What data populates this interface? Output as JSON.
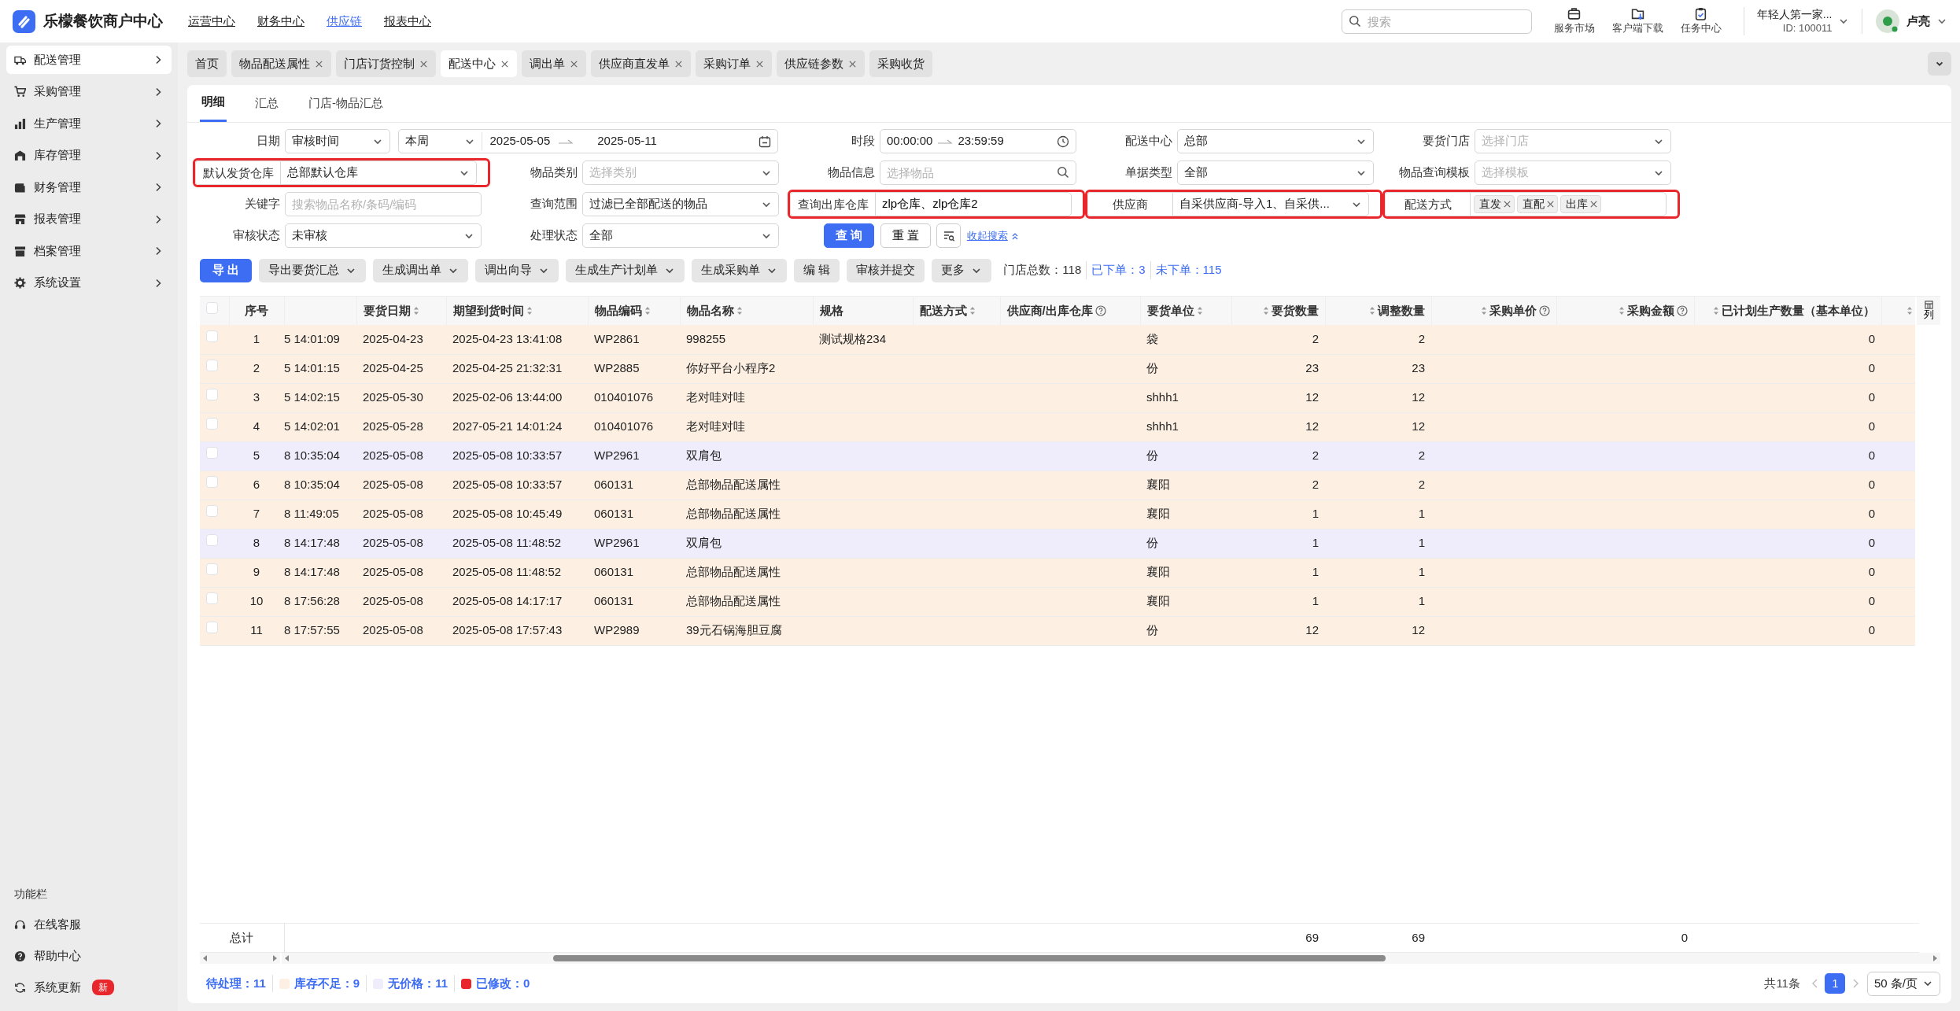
{
  "app": {
    "name": "乐檬餐饮商户中心"
  },
  "top_nav": [
    {
      "label": "运营中心",
      "selected": false
    },
    {
      "label": "财务中心",
      "selected": false
    },
    {
      "label": "供应链",
      "selected": true
    },
    {
      "label": "报表中心",
      "selected": false
    }
  ],
  "search": {
    "placeholder": "搜索"
  },
  "shortcuts": [
    {
      "label": "服务市场"
    },
    {
      "label": "客户端下载"
    },
    {
      "label": "任务中心"
    }
  ],
  "account": {
    "name": "年轻人第一家...",
    "id": "ID: 100011"
  },
  "user": {
    "name": "卢亮"
  },
  "sidebar": {
    "items": [
      {
        "label": "配送管理",
        "selected": true
      },
      {
        "label": "采购管理",
        "selected": false
      },
      {
        "label": "生产管理",
        "selected": false
      },
      {
        "label": "库存管理",
        "selected": false
      },
      {
        "label": "财务管理",
        "selected": false
      },
      {
        "label": "报表管理",
        "selected": false
      },
      {
        "label": "档案管理",
        "selected": false
      },
      {
        "label": "系统设置",
        "selected": false
      }
    ],
    "footer_title": "功能栏",
    "footer_items": [
      {
        "label": "在线客服"
      },
      {
        "label": "帮助中心"
      },
      {
        "label": "系统更新",
        "badge": "新"
      }
    ]
  },
  "page_tabs": [
    {
      "label": "首页",
      "selected": false,
      "closable": false
    },
    {
      "label": "物品配送属性",
      "selected": false,
      "closable": true
    },
    {
      "label": "门店订货控制",
      "selected": false,
      "closable": true
    },
    {
      "label": "配送中心",
      "selected": true,
      "closable": true
    },
    {
      "label": "调出单",
      "selected": false,
      "closable": true
    },
    {
      "label": "供应商直发单",
      "selected": false,
      "closable": true
    },
    {
      "label": "采购订单",
      "selected": false,
      "closable": true
    },
    {
      "label": "供应链参数",
      "selected": false,
      "closable": true
    },
    {
      "label": "采购收货",
      "selected": false,
      "closable": false
    }
  ],
  "sub_tabs": [
    {
      "label": "明细",
      "selected": true
    },
    {
      "label": "汇总",
      "selected": false
    },
    {
      "label": "门店-物品汇总",
      "selected": false
    }
  ],
  "filters": [
    {
      "label": "日期",
      "kind": "date",
      "type": "审核时间",
      "period": "本周",
      "start": "2025-05-05",
      "end": "2025-05-11",
      "highlighted": false
    },
    {
      "label": "时段",
      "kind": "time",
      "start": "00:00:00",
      "end": "23:59:59",
      "highlighted": false
    },
    {
      "label": "配送中心",
      "kind": "select",
      "value": "总部",
      "highlighted": false
    },
    {
      "label": "要货门店",
      "kind": "select",
      "placeholder": "选择门店",
      "highlighted": false
    },
    {
      "label": "默认发货仓库",
      "kind": "select",
      "value": "总部默认仓库",
      "highlighted": true
    },
    {
      "label": "物品类别",
      "kind": "select",
      "placeholder": "选择类别",
      "highlighted": false
    },
    {
      "label": "物品信息",
      "kind": "search",
      "placeholder": "选择物品",
      "highlighted": false
    },
    {
      "label": "单据类型",
      "kind": "select",
      "value": "全部",
      "highlighted": false
    },
    {
      "label": "物品查询模板",
      "kind": "select",
      "placeholder": "选择模板",
      "highlighted": false
    },
    {
      "label": "关键字",
      "kind": "text",
      "placeholder": "搜索物品名称/条码/编码",
      "highlighted": false
    },
    {
      "label": "查询范围",
      "kind": "select",
      "value": "过滤已全部配送的物品",
      "highlighted": false
    },
    {
      "label": "查询出库仓库",
      "kind": "text",
      "value": "zlp仓库、zlp仓库2",
      "highlighted": true
    },
    {
      "label": "供应商",
      "kind": "select",
      "value": "自采供应商-导入1、自采供...",
      "highlighted": true
    },
    {
      "label": "配送方式",
      "kind": "tags",
      "tags": [
        "直发",
        "直配",
        "出库"
      ],
      "highlighted": true
    },
    {
      "label": "审核状态",
      "kind": "select",
      "value": "未审核",
      "highlighted": false
    },
    {
      "label": "处理状态",
      "kind": "select",
      "value": "全部",
      "highlighted": false
    }
  ],
  "search_actions": {
    "buttons": [
      {
        "label": "查 询",
        "primary": true
      },
      {
        "label": "重 置",
        "primary": false
      }
    ],
    "collapse_link": "收起搜索"
  },
  "toolbar": {
    "buttons": [
      {
        "label": "导 出",
        "primary": true,
        "dropdown": false
      },
      {
        "label": "导出要货汇总",
        "primary": false,
        "dropdown": true
      },
      {
        "label": "生成调出单",
        "primary": false,
        "dropdown": true
      },
      {
        "label": "调出向导",
        "primary": false,
        "dropdown": true
      },
      {
        "label": "生成生产计划单",
        "primary": false,
        "dropdown": true
      },
      {
        "label": "生成采购单",
        "primary": false,
        "dropdown": true
      },
      {
        "label": "编 辑",
        "primary": false,
        "dropdown": false
      },
      {
        "label": "审核并提交",
        "primary": false,
        "dropdown": false
      },
      {
        "label": "更多",
        "primary": false,
        "dropdown": true
      }
    ],
    "stats": [
      {
        "label": "门店总数：118",
        "link": false
      },
      {
        "label": "已下单：3",
        "link": true
      },
      {
        "label": "未下单：115",
        "link": true
      }
    ]
  },
  "table": {
    "select_all": {
      "checked": false
    },
    "columns": [
      {
        "label": "序号",
        "sortable": false,
        "help": false
      },
      {
        "sortable": false,
        "help": false
      },
      {
        "label": "要货日期",
        "sortable": true,
        "help": false
      },
      {
        "label": "期望到货时间",
        "sortable": true,
        "help": false
      },
      {
        "label": "物品编码",
        "sortable": true,
        "help": false
      },
      {
        "label": "物品名称",
        "sortable": true,
        "help": false
      },
      {
        "label": "规格",
        "sortable": false,
        "help": false
      },
      {
        "label": "配送方式",
        "sortable": true,
        "help": false
      },
      {
        "label": "供应商/出库仓库",
        "sortable": false,
        "help": true
      },
      {
        "label": "要货单位",
        "sortable": true,
        "help": false
      },
      {
        "label": "要货数量",
        "sortable": true,
        "help": false
      },
      {
        "label": "调整数量",
        "sortable": true,
        "help": false
      },
      {
        "label": "采购单价",
        "sortable": true,
        "help": true
      },
      {
        "label": "采购金额",
        "sortable": true,
        "help": true
      },
      {
        "label": "已计划生产数量（基本单位）",
        "sortable": true,
        "help": false
      },
      {
        "sortable": true,
        "help": false
      }
    ],
    "column_settings": {
      "label": "列"
    },
    "rows": [
      {
        "checked": false,
        "low_stock": true,
        "no_price": false,
        "no": "1",
        "column_2": "5 14:01:09",
        "date": "2025-04-23",
        "expected": "2025-04-23 13:41:08",
        "code": "WP2861",
        "name": "998255",
        "spec": "测试规格234",
        "unit": "袋",
        "qty": "2",
        "adjusted": "2",
        "planned": "0"
      },
      {
        "checked": false,
        "low_stock": true,
        "no_price": false,
        "no": "2",
        "column_2": "5 14:01:15",
        "date": "2025-04-25",
        "expected": "2025-04-25 21:32:31",
        "code": "WP2885",
        "name": "你好平台小程序2",
        "unit": "份",
        "qty": "23",
        "adjusted": "23",
        "planned": "0"
      },
      {
        "checked": false,
        "low_stock": true,
        "no_price": false,
        "no": "3",
        "column_2": "5 14:02:15",
        "date": "2025-05-30",
        "expected": "2025-02-06 13:44:00",
        "code": "010401076",
        "name": "老对哇对哇",
        "unit": "shhh1",
        "qty": "12",
        "adjusted": "12",
        "planned": "0"
      },
      {
        "checked": false,
        "low_stock": true,
        "no_price": false,
        "no": "4",
        "column_2": "5 14:02:01",
        "date": "2025-05-28",
        "expected": "2027-05-21 14:01:24",
        "code": "010401076",
        "name": "老对哇对哇",
        "unit": "shhh1",
        "qty": "12",
        "adjusted": "12",
        "planned": "0"
      },
      {
        "checked": false,
        "low_stock": false,
        "no_price": true,
        "no": "5",
        "column_2": "8 10:35:04",
        "date": "2025-05-08",
        "expected": "2025-05-08 10:33:57",
        "code": "WP2961",
        "name": "双肩包",
        "unit": "份",
        "qty": "2",
        "adjusted": "2",
        "planned": "0"
      },
      {
        "checked": false,
        "low_stock": true,
        "no_price": false,
        "no": "6",
        "column_2": "8 10:35:04",
        "date": "2025-05-08",
        "expected": "2025-05-08 10:33:57",
        "code": "060131",
        "name": "总部物品配送属性",
        "unit": "襄阳",
        "qty": "2",
        "adjusted": "2",
        "planned": "0"
      },
      {
        "checked": false,
        "low_stock": true,
        "no_price": false,
        "no": "7",
        "column_2": "8 11:49:05",
        "date": "2025-05-08",
        "expected": "2025-05-08 10:45:49",
        "code": "060131",
        "name": "总部物品配送属性",
        "unit": "襄阳",
        "qty": "1",
        "adjusted": "1",
        "planned": "0"
      },
      {
        "checked": false,
        "low_stock": false,
        "no_price": true,
        "no": "8",
        "column_2": "8 14:17:48",
        "date": "2025-05-08",
        "expected": "2025-05-08 11:48:52",
        "code": "WP2961",
        "name": "双肩包",
        "unit": "份",
        "qty": "1",
        "adjusted": "1",
        "planned": "0"
      },
      {
        "checked": false,
        "low_stock": true,
        "no_price": false,
        "no": "9",
        "column_2": "8 14:17:48",
        "date": "2025-05-08",
        "expected": "2025-05-08 11:48:52",
        "code": "060131",
        "name": "总部物品配送属性",
        "unit": "襄阳",
        "qty": "1",
        "adjusted": "1",
        "planned": "0"
      },
      {
        "checked": false,
        "low_stock": true,
        "no_price": false,
        "no": "10",
        "column_2": "8 17:56:28",
        "date": "2025-05-08",
        "expected": "2025-05-08 14:17:17",
        "code": "060131",
        "name": "总部物品配送属性",
        "unit": "襄阳",
        "qty": "1",
        "adjusted": "1",
        "planned": "0"
      },
      {
        "checked": false,
        "low_stock": true,
        "no_price": false,
        "no": "11",
        "column_2": "8 17:57:55",
        "date": "2025-05-08",
        "expected": "2025-05-08 17:57:43",
        "code": "WP2989",
        "name": "39元石锅海胆豆腐",
        "unit": "份",
        "qty": "12",
        "adjusted": "12",
        "planned": "0"
      }
    ],
    "totals": {
      "label": "总计",
      "qty": "69",
      "adjusted": "69",
      "amount": "0"
    }
  },
  "legend": [
    {
      "label": "待处理：11"
    },
    {
      "label": "库存不足：9",
      "color": "#fdf0e3"
    },
    {
      "label": "无价格：11",
      "color": "#efecfb"
    },
    {
      "label": "已修改：0",
      "color": "#e8262b"
    }
  ],
  "pagination": {
    "total": "共11条",
    "pages": [
      {
        "label": "1",
        "selected": true
      }
    ],
    "page_size": "50 条/页"
  }
}
